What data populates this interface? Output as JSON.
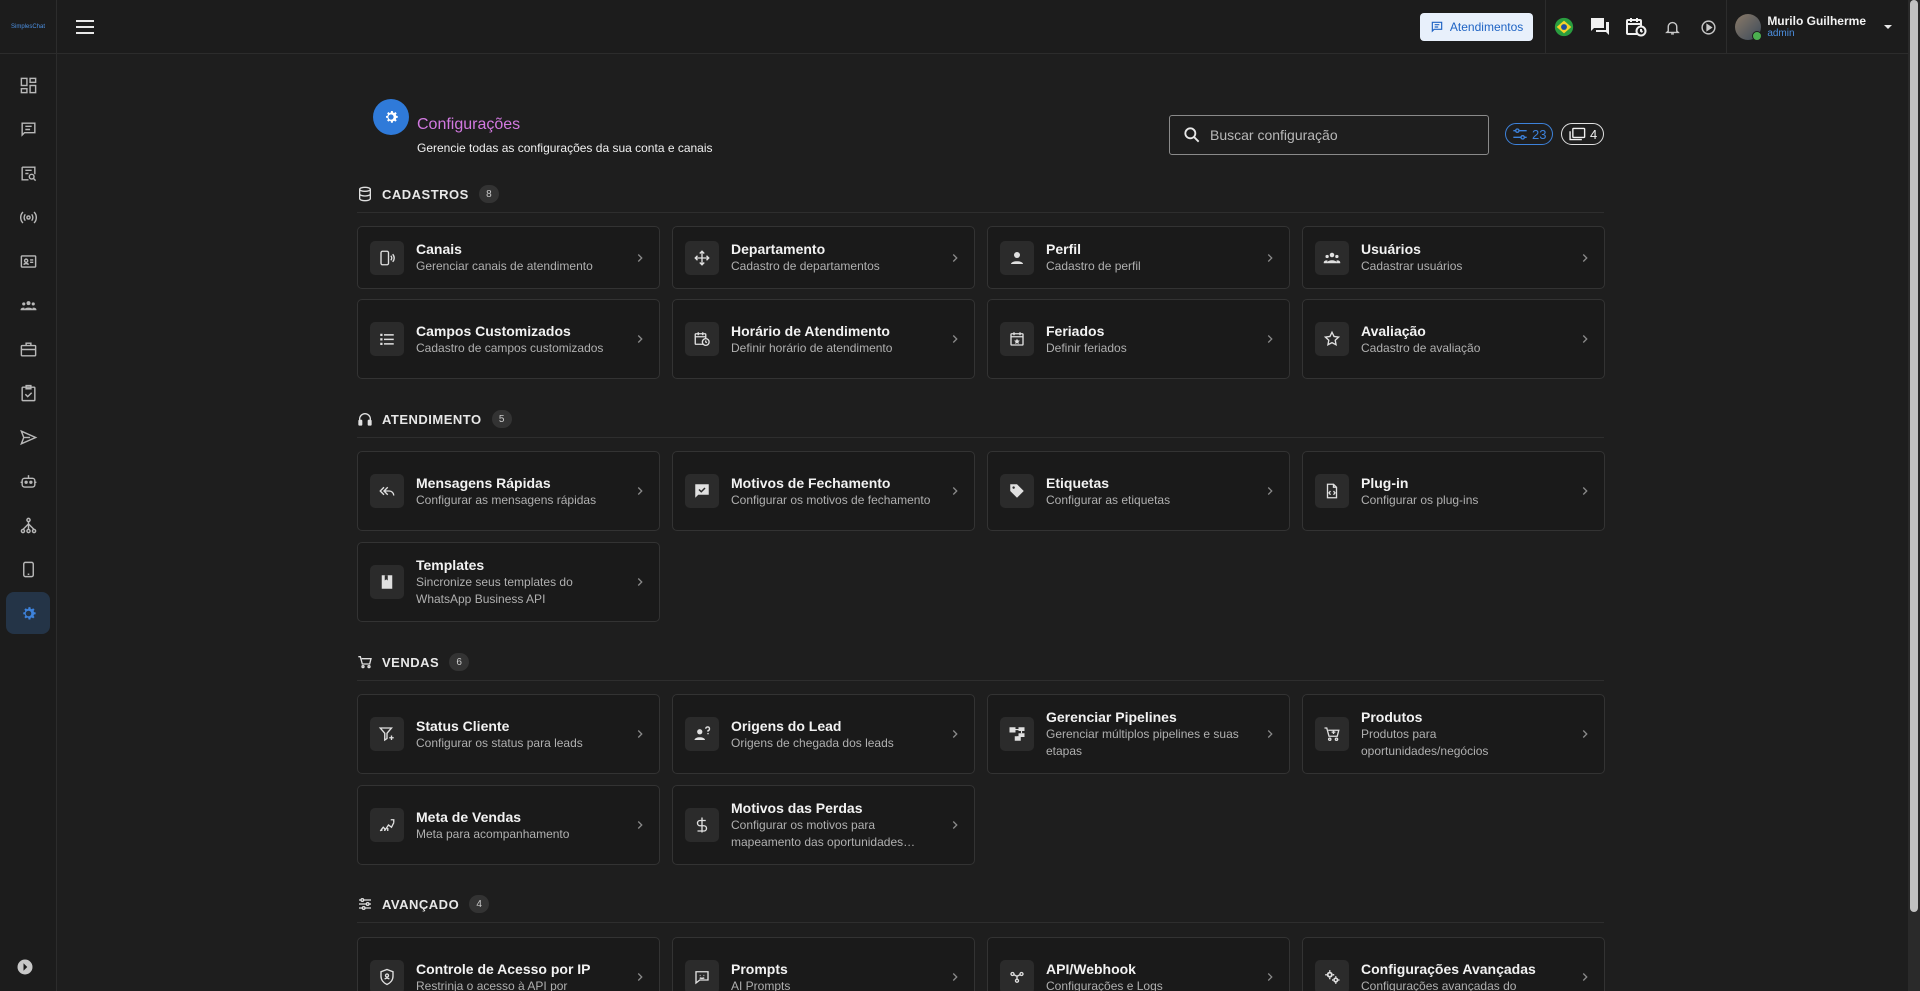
{
  "app": {
    "logo_text": "SimplesChat"
  },
  "topbar": {
    "atendimentos_label": "Atendimentos",
    "user": {
      "name": "Murilo Guilherme",
      "role": "admin"
    }
  },
  "header": {
    "title": "Configurações",
    "subtitle": "Gerencie todas as configurações da sua conta e canais",
    "search_placeholder": "Buscar configuração",
    "total_count": "23",
    "group_count": "4"
  },
  "sections": [
    {
      "label": "CADASTROS",
      "count": "8",
      "cards": [
        {
          "title": "Canais",
          "desc": "Gerenciar canais de atendimento",
          "icon": "phone-sound-icon"
        },
        {
          "title": "Departamento",
          "desc": "Cadastro de departamentos",
          "icon": "move-arrows-icon"
        },
        {
          "title": "Perfil",
          "desc": "Cadastro de perfil",
          "icon": "person-icon"
        },
        {
          "title": "Usuários",
          "desc": "Cadastrar usuários",
          "icon": "group-icon"
        },
        {
          "title": "Campos Customizados",
          "desc": "Cadastro de campos customizados",
          "icon": "list-icon"
        },
        {
          "title": "Horário de Atendimento",
          "desc": "Definir horário de atendimento",
          "icon": "calendar-clock-icon"
        },
        {
          "title": "Feriados",
          "desc": "Definir feriados",
          "icon": "calendar-star-icon"
        },
        {
          "title": "Avaliação",
          "desc": "Cadastro de avaliação",
          "icon": "star-icon"
        }
      ]
    },
    {
      "label": "ATENDIMENTO",
      "count": "5",
      "cards": [
        {
          "title": "Mensagens Rápidas",
          "desc": "Configurar as mensagens rápidas",
          "icon": "reply-all-icon"
        },
        {
          "title": "Motivos de Fechamento",
          "desc": "Configurar os motivos de fechamento",
          "icon": "chat-check-icon"
        },
        {
          "title": "Etiquetas",
          "desc": "Configurar as etiquetas",
          "icon": "tag-icon"
        },
        {
          "title": "Plug-in",
          "desc": "Configurar os plug-ins",
          "icon": "code-file-icon"
        },
        {
          "title": "Templates",
          "desc": "Sincronize seus templates do WhatsApp Business API",
          "icon": "book-icon"
        }
      ]
    },
    {
      "label": "VENDAS",
      "count": "6",
      "cards": [
        {
          "title": "Status Cliente",
          "desc": "Configurar os status para leads",
          "icon": "filter-plus-icon"
        },
        {
          "title": "Origens do Lead",
          "desc": "Origens de chegada dos leads",
          "icon": "person-question-icon"
        },
        {
          "title": "Gerenciar Pipelines",
          "desc": "Gerenciar múltiplos pipelines e suas etapas",
          "icon": "pipeline-icon"
        },
        {
          "title": "Produtos",
          "desc": "Produtos para oportunidades/negócios",
          "icon": "cart-plus-icon"
        },
        {
          "title": "Meta de Vendas",
          "desc": "Meta para acompanhamento",
          "icon": "chart-up-icon"
        },
        {
          "title": "Motivos das Perdas",
          "desc": "Configurar os motivos para mapeamento das oportunidades…",
          "icon": "dollar-icon"
        }
      ]
    },
    {
      "label": "AVANÇADO",
      "count": "4",
      "cards": [
        {
          "title": "Controle de Acesso por IP",
          "desc": "Restrinja o acesso à API por",
          "icon": "shield-icon"
        },
        {
          "title": "Prompts",
          "desc": "AI Prompts",
          "icon": "ai-chat-icon"
        },
        {
          "title": "API/Webhook",
          "desc": "Configurações e Logs",
          "icon": "webhook-icon"
        },
        {
          "title": "Configurações Avançadas",
          "desc": "Configurações avançadas do",
          "icon": "gears-icon"
        }
      ]
    }
  ]
}
